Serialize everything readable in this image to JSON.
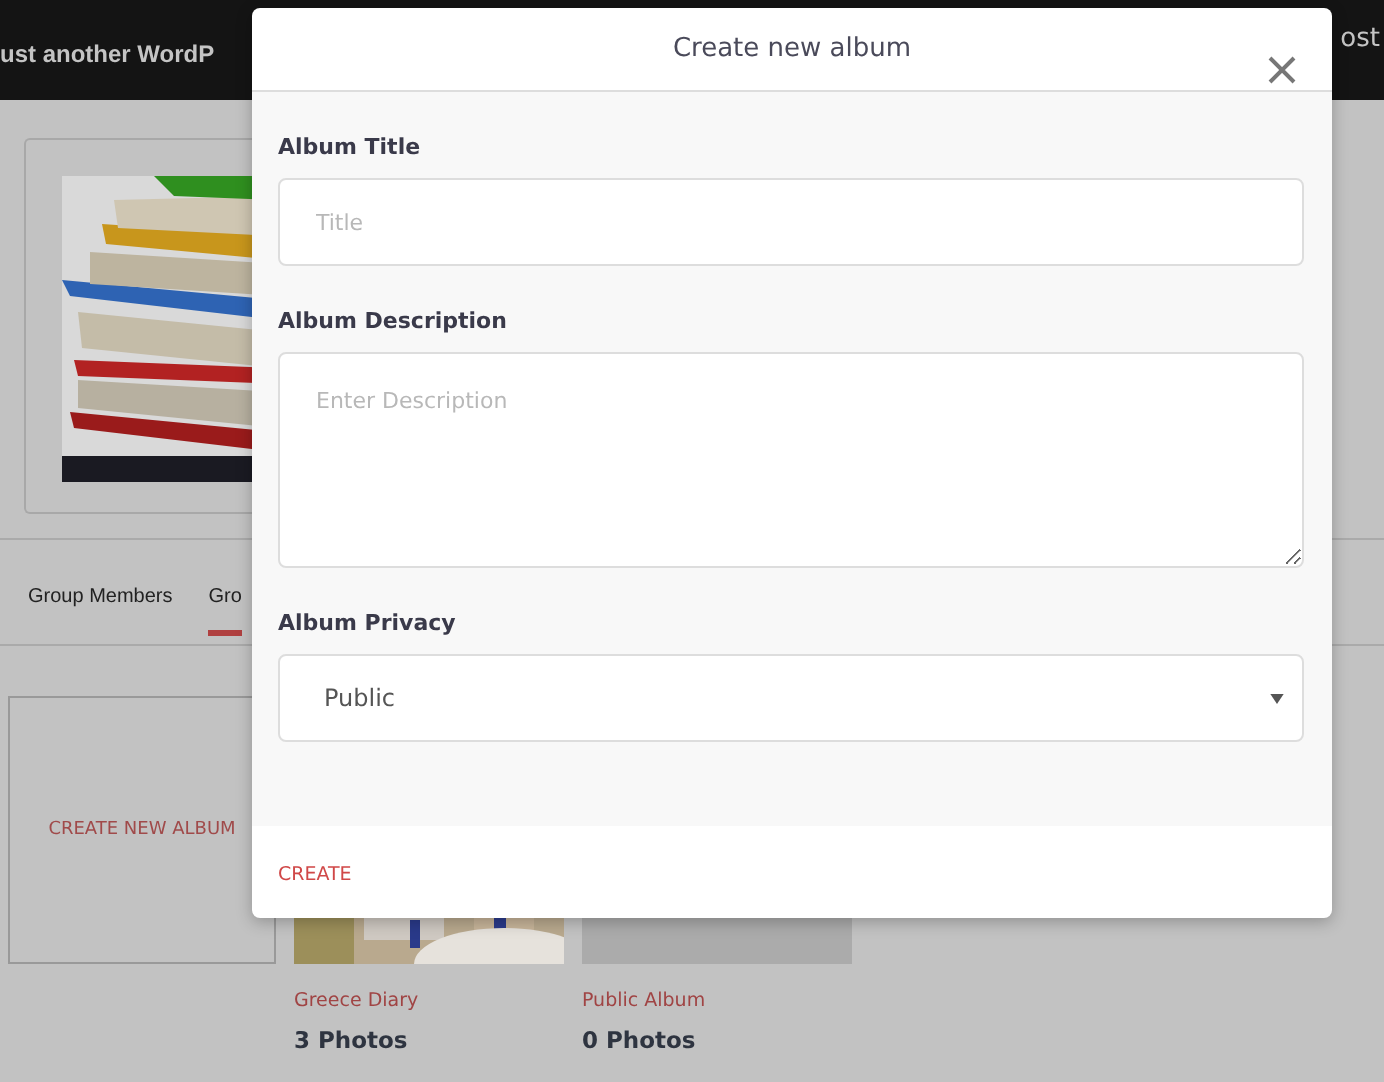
{
  "header": {
    "tagline": "ust another WordP",
    "side_text": "ost"
  },
  "group": {
    "tabs": [
      {
        "label": "Group Members",
        "selected": false
      },
      {
        "label": "Gro",
        "selected": true
      }
    ]
  },
  "albums": {
    "create_tile": "CREATE NEW ALBUM",
    "items": [
      {
        "kind": "picture",
        "title": "Greece Diary",
        "count": "3 Photos"
      },
      {
        "kind": "empty",
        "title": "Public Album",
        "count": "0 Photos"
      }
    ]
  },
  "modal": {
    "title": "Create new album",
    "fields": [
      {
        "kind": "text",
        "label": "Album Title",
        "placeholder": "Title"
      },
      {
        "kind": "textarea",
        "label": "Album Description",
        "placeholder": "Enter Description"
      },
      {
        "kind": "select",
        "label": "Album Privacy",
        "value": "Public"
      }
    ],
    "submit": "CREATE"
  }
}
